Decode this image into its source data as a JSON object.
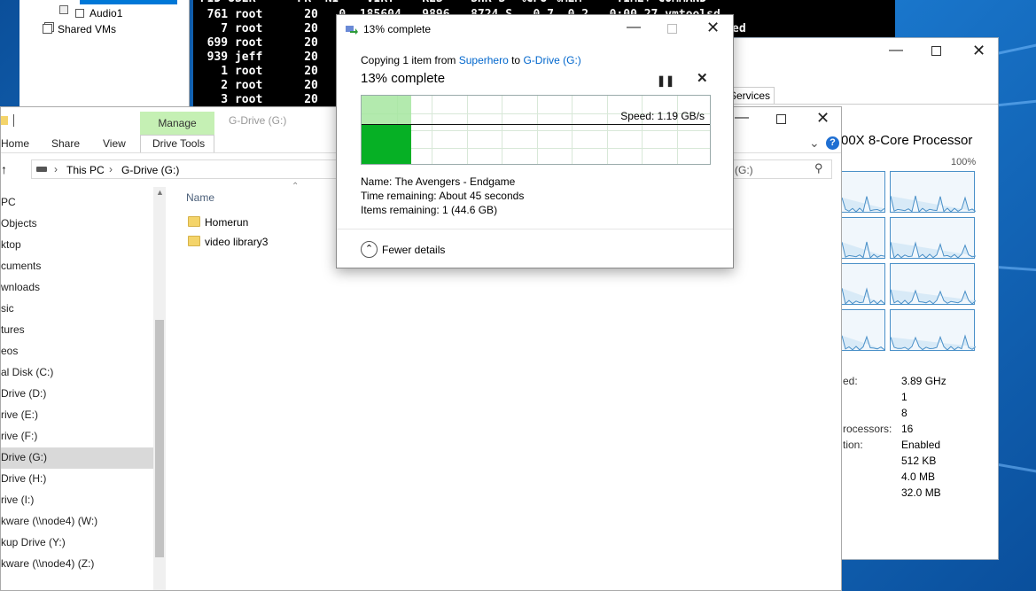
{
  "vm_manager": {
    "items": [
      {
        "label": "Audio1"
      },
      {
        "label": "Shared VMs"
      }
    ]
  },
  "terminal": {
    "rows": [
      "  761 root      20   0  185604   9896   8724 S   0.7  0.2   0:00.27 vmtoolsd",
      "    7 root      20",
      "  699 root      20",
      "  939 jeff      20",
      "    1 root      20",
      "    2 root      20",
      "    3 root      20"
    ],
    "extra_right": "ed"
  },
  "task_manager": {
    "tab_label": "Services",
    "processor_title": "00X 8-Core Processor",
    "percent_max": "100%",
    "stats": [
      {
        "label": "ed:",
        "value": "3.89 GHz"
      },
      {
        "label": "",
        "value": "1"
      },
      {
        "label": "",
        "value": "8"
      },
      {
        "label": "rocessors:",
        "value": "16"
      },
      {
        "label": "tion:",
        "value": "Enabled"
      },
      {
        "label": "",
        "value": "512 KB"
      },
      {
        "label": "",
        "value": "4.0 MB"
      },
      {
        "label": "",
        "value": "32.0 MB"
      }
    ]
  },
  "explorer": {
    "manage_tab": "Manage",
    "title": "G-Drive (G:)",
    "ribbon_tabs": [
      "Home",
      "Share",
      "View",
      "Drive Tools"
    ],
    "breadcrumb": [
      "This PC",
      "G-Drive (G:)"
    ],
    "search_text": "(G:)",
    "column_name": "Name",
    "files": [
      {
        "name": "Homerun"
      },
      {
        "name": "video library3"
      }
    ],
    "nav": [
      "PC",
      "Objects",
      "ktop",
      "cuments",
      "wnloads",
      "sic",
      "tures",
      "eos",
      "al Disk (C:)",
      "Drive (D:)",
      "rive (E:)",
      "rive (F:)",
      "Drive (G:)",
      "Drive (H:)",
      "rive (I:)",
      "kware (\\\\node4) (W:)",
      "kup Drive (Y:)",
      "kware (\\\\node4) (Z:)"
    ],
    "nav_selected_index": 12
  },
  "copy_dialog": {
    "title": "13% complete",
    "copying_prefix": "Copying 1 item from ",
    "source": "Superhero",
    "to_word": " to ",
    "destination": "G-Drive (G:)",
    "heading": "13% complete",
    "speed": "Speed: 1.19 GB/s",
    "progress_fraction": 0.13,
    "name_line": "Name:  The Avengers - Endgame",
    "time_line": "Time remaining:  About 45 seconds",
    "items_line": "Items remaining:  1 (44.6 GB)",
    "fewer_details": "Fewer details",
    "colors": {
      "progress": "#06b025",
      "progress_light": "#a6e6a0",
      "link": "#0066cc"
    }
  }
}
